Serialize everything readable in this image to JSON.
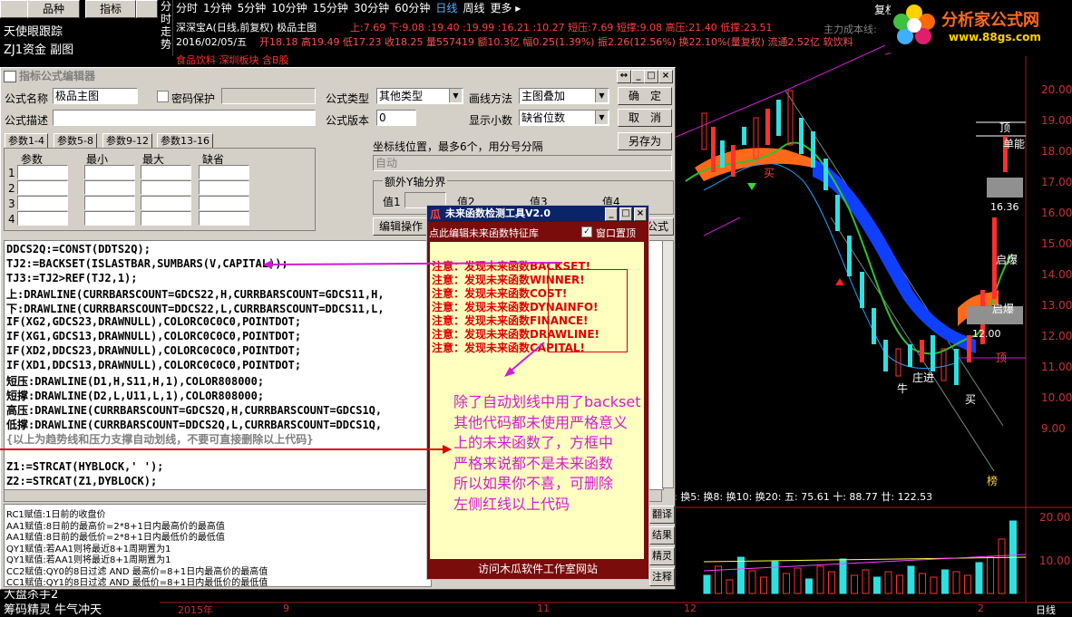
{
  "left_panel": {
    "tabs": [
      "",
      "品种",
      "指标",
      ""
    ],
    "items": [
      "天使眼跟踪",
      "ZJ1资金 副图"
    ],
    "bottom_items": [
      "大盘杀手2",
      "筹码精灵 牛气冲天"
    ]
  },
  "chart": {
    "side_label": "分时走势",
    "periods": [
      "分时",
      "1分钟",
      "5分钟",
      "10分钟",
      "15分钟",
      "30分钟",
      "60分钟",
      "日线",
      "周线",
      "更多 ▸"
    ],
    "right_tab": "复权",
    "stock_title": "深深宝A(日线,前复权) 极品主图",
    "stock_values_1": "上:7.69 下:9.08 :19.40 :19.99 :16.21 :10.27 短压:7.69 短撑:9.08 高压:21.40 低撑:23.51",
    "main_cost": "主力成本线:",
    "date_line": "2016/02/05/五",
    "quote_line": "开18.18 高19.49 低17.23 收18.25 量557419 额10.3亿 幅0.25(1.39%) 振2.26(12.56%) 换22.10%(量复权) 流通2.52亿 软饮料",
    "sector_line": "食品饮料 深圳板块 含B股",
    "y_axis": [
      "20.00",
      "19.00",
      "18.00",
      "17.00",
      "16.00",
      "15.00",
      "14.00",
      "13.00",
      "12.00",
      "11.00",
      "10.00",
      "9.00"
    ],
    "price_tags": [
      "16.36",
      "12.00"
    ],
    "chart_labels": [
      "买",
      "庄进",
      "牛",
      "买",
      "顶",
      "单能",
      "启爆",
      "启爆",
      "顶",
      "榜"
    ],
    "sub_indicator": "3: 换5: 换8: 换10: 换20: 五: 75.61 十: 88.77 廿: 122.53",
    "sub_y_axis": [
      "20.00",
      "10.00"
    ],
    "x_axis": [
      "2015年",
      "9",
      "11",
      "12",
      "2",
      "日线"
    ],
    "sub_buttons": [
      "翻译",
      "结果",
      "精灵",
      "注释"
    ]
  },
  "logo": {
    "title": "分析家公式网",
    "url": "www.88gs.com"
  },
  "editor": {
    "title": "指标公式编辑器",
    "name_label": "公式名称",
    "name_value": "极品主图",
    "password_label": "密码保护",
    "desc_label": "公式描述",
    "type_label": "公式类型",
    "type_value": "其他类型",
    "draw_label": "画线方法",
    "draw_value": "主图叠加",
    "version_label": "公式版本",
    "version_value": "0",
    "decimal_label": "显示小数",
    "decimal_value": "缺省位数",
    "ok": "确　定",
    "cancel": "取　消",
    "saveas": "另存为",
    "tabs": [
      "参数1-4",
      "参数5-8",
      "参数9-12",
      "参数13-16"
    ],
    "param_headers": [
      "参数",
      "最小",
      "最大",
      "缺省"
    ],
    "rows": [
      "1",
      "2",
      "3",
      "4"
    ],
    "coord_label": "坐标线位置，最多6个，用分号分隔",
    "coord_value": "自动",
    "extra_y": "额外Y轴分界",
    "vals": [
      "值1",
      "值2",
      "值3",
      "值4"
    ],
    "edit_op": "编辑操作",
    "formula_btn": "公式",
    "code": [
      "DDCS2Q:=CONST(DDTS2Q);",
      "TJ2:=BACKSET(ISLASTBAR,SUMBARS(V,CAPITAL));",
      "TJ3:=TJ2>REF(TJ2,1);",
      "上:DRAWLINE(CURRBARSCOUNT=GDCS22,H,CURRBARSCOUNT=GDCS11,H,",
      "下:DRAWLINE(CURRBARSCOUNT=DDCS22,L,CURRBARSCOUNT=DDCS11,L,",
      "IF(XG2,GDCS23,DRAWNULL),COLORC0C0C0,POINTDOT;",
      "IF(XG1,GDCS13,DRAWNULL),COLORC0C0C0,POINTDOT;",
      "IF(XD2,DDCS23,DRAWNULL),COLORC0C0C0,POINTDOT;",
      "IF(XD1,DDCS13,DRAWNULL),COLORC0C0C0,POINTDOT;",
      "短压:DRAWLINE(D1,H,S11,H,1),COLOR808000;",
      "短撑:DRAWLINE(D2,L,U11,L,1),COLOR808000;",
      "高压:DRAWLINE(CURRBARSCOUNT=GDCS2Q,H,CURRBARSCOUNT=GDCS1Q,",
      "低撑:DRAWLINE(CURRBARSCOUNT=DDCS2Q,L,CURRBARSCOUNT=DDCS1Q,",
      "{以上为趋势线和压力支撑自动划线，不要可直接删除以上代码}",
      "",
      "Z1:=STRCAT(HYBLOCK,' ');",
      " Z2:=STRCAT(Z1,DYBLOCK);"
    ],
    "notes": [
      "RC1赋值:1日前的收盘价",
      "AA1赋值:8日前的最高价=2*8+1日内最高价的最高值",
      "AA1赋值:8日前的最低价=2*8+1日内最低价的最低值",
      "QY1赋值:若AA1则将最近8+1周期置为1",
      "QY1赋值:若AA1则将最近8+1周期置为1",
      "CC2赋值:QY0的8日过滤 AND 最高价=8+1日内最高价的最高值",
      "CC1赋值:QY1的8日过滤 AND 最低价=8+1日内最低价的最低值"
    ]
  },
  "popup": {
    "title": "未来函数检测工具V2.0",
    "subtitle": "点此编辑未来函数特征库",
    "checkbox_label": "窗口置顶",
    "warnings": [
      "注意：发现未来函数BACKSET!",
      "注意：发现未来函数WINNER!",
      "注意：发现未来函数COST!",
      "注意：发现未来函数DYNAINFO!",
      "注意：发现未来函数FINANCE!",
      "注意：发现未来函数DRAWLINE!",
      "注意：发现未来函数CAPITAL!"
    ],
    "footer": "访问木瓜软件工作室网站"
  },
  "annotation": {
    "lines": [
      "除了自动划线中用了backset",
      "其他代码都未使用严格意义",
      "上的未来函数了，方框中",
      "严格来说都不是未来函数",
      "所以如果你不喜，可删除",
      "左侧红线以上代码"
    ]
  },
  "colors": {
    "pink": "#d21bd2",
    "red": "#e00000",
    "blue": "#1040ff",
    "orange": "#ff6a1a"
  }
}
